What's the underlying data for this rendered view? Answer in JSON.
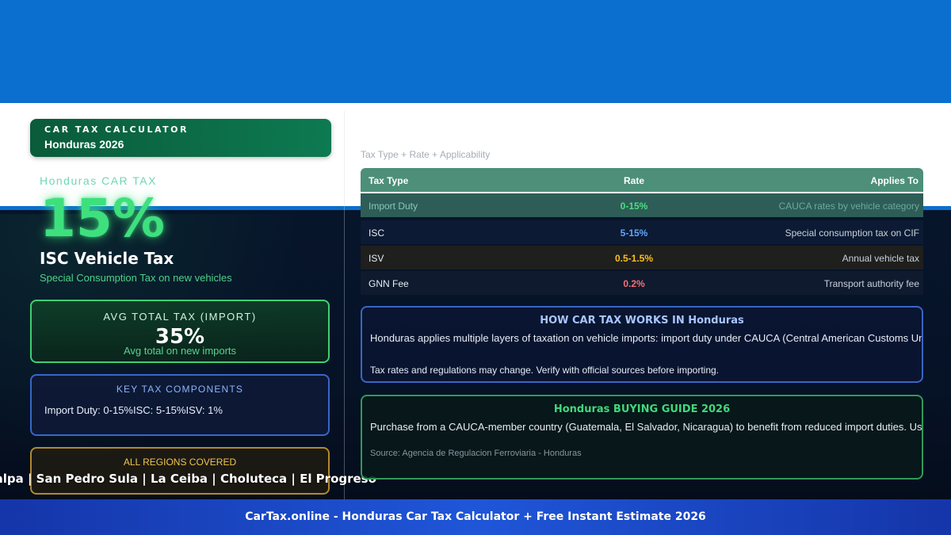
{
  "brand": {
    "title": "CAR TAX CALCULATOR",
    "subtitle": "Honduras 2026"
  },
  "hero": {
    "country_label": "Honduras CAR TAX",
    "rate": "15%",
    "tax_name": "ISC Vehicle Tax",
    "tax_desc": "Special Consumption Tax on new vehicles"
  },
  "avg_card": {
    "label": "AVG TOTAL TAX (IMPORT)",
    "value": "35%",
    "note": "Avg total on new imports"
  },
  "components_card": {
    "label": "KEY TAX COMPONENTS",
    "items": "Import Duty: 0-15%ISC: 5-15%ISV: 1%"
  },
  "regions_card": {
    "label": "ALL REGIONS COVERED",
    "list": "Tegucigalpa | San Pedro Sula | La Ceiba | Choluteca | El Progreso"
  },
  "tax_table": {
    "caption": "Tax Type + Rate + Applicability",
    "headers": [
      "Tax Type",
      "Rate",
      "Applies To"
    ],
    "rows": [
      {
        "type": "Import Duty",
        "rate": "0-15%",
        "applies": "CAUCA rates by vehicle category"
      },
      {
        "type": "ISC",
        "rate": "5-15%",
        "applies": "Special consumption tax on CIF"
      },
      {
        "type": "ISV",
        "rate": "0.5-1.5%",
        "applies": "Annual vehicle tax"
      },
      {
        "type": "GNN Fee",
        "rate": "0.2%",
        "applies": "Transport authority fee"
      }
    ]
  },
  "how_card": {
    "title": "HOW CAR TAX WORKS IN Honduras",
    "text": "Honduras applies multiple layers of taxation on vehicle imports: import duty under CAUCA (Central American Customs Union), a",
    "note": "Tax rates and regulations may change. Verify with official sources before importing."
  },
  "guide_card": {
    "title": "Honduras BUYING GUIDE 2026",
    "text": "Purchase from a CAUCA-member country (Guatemala, El Salvador, Nicaragua) to benefit from reduced import duties. Used veh",
    "source": "Source: Agencia de Regulacion Ferroviaria - Honduras"
  },
  "footer": {
    "text": "CarTax.online - Honduras Car Tax Calculator + Free Instant Estimate 2026"
  },
  "colors": {
    "top_bar": "#0a6fce",
    "accent_green": "#3ee07e",
    "rate_green": "#4ade80",
    "rate_blue": "#60a5fa",
    "rate_amber": "#fbbf24",
    "rate_red": "#f87171",
    "footer_blue": "#1f56d8"
  }
}
